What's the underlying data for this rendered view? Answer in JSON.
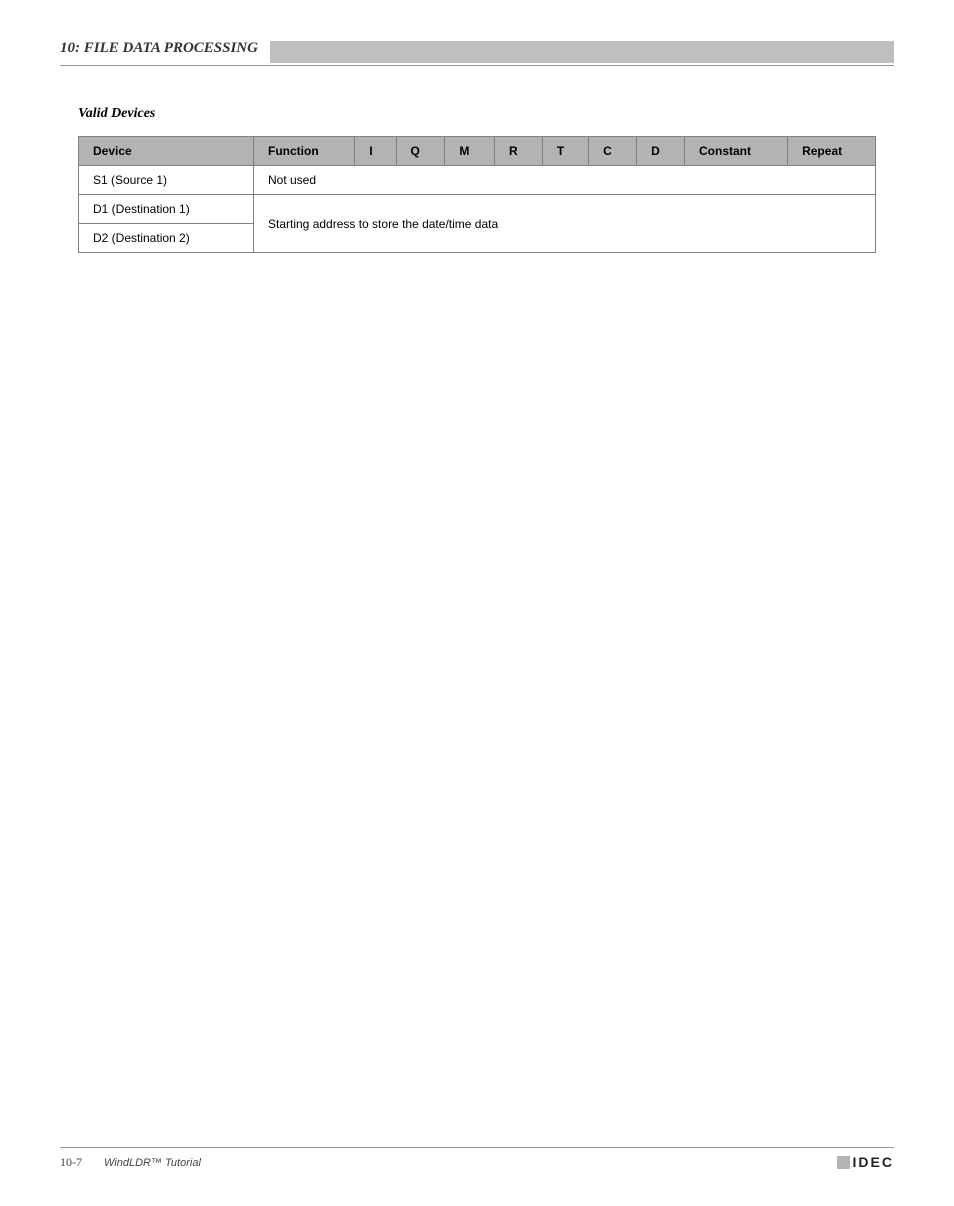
{
  "header": {
    "chapter": "10: FILE DATA PROCESSING",
    "banner": ""
  },
  "section_title": "Valid Devices",
  "table": {
    "headers": {
      "device": "Device",
      "function": "Function",
      "i": "I",
      "q": "Q",
      "m": "M",
      "r": "R",
      "t": "T",
      "c": "C",
      "d": "D",
      "constant": "Constant",
      "repeat": "Repeat"
    },
    "rows": [
      {
        "device": "S1 (Source 1)",
        "rest": "Not used"
      },
      {
        "device": "D1 (Destination 1)",
        "rest_merged_top": "Starting address to store the date/time data"
      },
      {
        "device": "D2 (Destination 2)",
        "rest_merged_bottom": ""
      }
    ]
  },
  "footer": {
    "page": "10-7",
    "manual": "WindLDR™ Tutorial",
    "logo": "IDEC"
  }
}
